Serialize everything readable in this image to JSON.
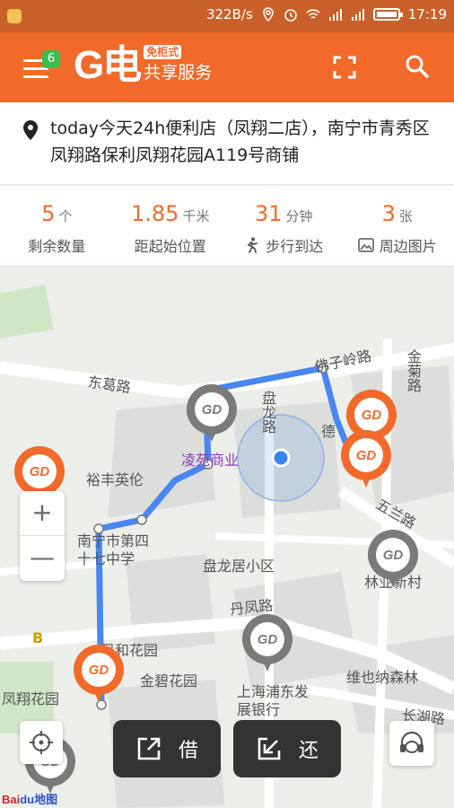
{
  "status_bar": {
    "speed": "322B/s",
    "time": "17:19"
  },
  "app_bar": {
    "badge": "6",
    "brand": "G电",
    "tag": "免柜式",
    "subtitle": "共享服务"
  },
  "address": {
    "text": "today今天24h便利店（凤翔二店），南宁市青秀区凤翔路保利凤翔花园A119号商铺"
  },
  "stats": [
    {
      "value": "5",
      "unit": "个",
      "label": "剩余数量",
      "icon": ""
    },
    {
      "value": "1.85",
      "unit": "千米",
      "label": "距起始位置",
      "icon": ""
    },
    {
      "value": "31",
      "unit": "分钟",
      "label": "步行到达",
      "icon": "walk-icon"
    },
    {
      "value": "3",
      "unit": "张",
      "label": "周边图片",
      "icon": "image-icon"
    }
  ],
  "map": {
    "labels": [
      "东葛路",
      "佛子岭路",
      "金菊路",
      "盘龙路",
      "凌苑商业",
      "裕丰英伦",
      "德",
      "南宁市第四十七中学",
      "盘龙居小区",
      "五兰路",
      "林业新村",
      "丹凤路",
      "凤和花园",
      "金碧花园",
      "维也纳森林",
      "上海浦东发展银行",
      "凤翔花园",
      "长湖路",
      "B"
    ],
    "zoom_in": "+",
    "zoom_out": "—",
    "pin_glyph": "GD",
    "baidu": {
      "a": "Bai",
      "b": "du地图"
    }
  },
  "actions": {
    "borrow": "借",
    "return": "还"
  },
  "colors": {
    "accent": "#f26a2a",
    "route": "#4a86f0",
    "status": "#c9602a"
  }
}
